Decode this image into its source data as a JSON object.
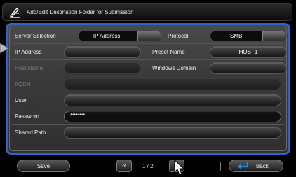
{
  "title": {
    "text": "Add/Edit Destination Folder for Submission",
    "icon": "folder-edit-icon"
  },
  "form": {
    "server_selection_label": "Server Selection",
    "server_selection_value": "IP Address",
    "protocol_label": "Protocol",
    "protocol_value": "SMB",
    "ip_address_label": "IP Address",
    "ip_address_value": "",
    "preset_name_label": "Preset Name",
    "preset_name_value": "HOST1",
    "host_name_label": "Host Name",
    "host_name_value": "",
    "windows_domain_label": "Windows Domain",
    "windows_domain_value": "",
    "fqdn_label": "FQDN",
    "fqdn_value": "",
    "user_label": "User",
    "user_value": "",
    "password_label": "Password",
    "password_value": "********",
    "shared_path_label": "Shared Path",
    "shared_path_value": ""
  },
  "footer": {
    "save_label": "Save",
    "prev_label": "«",
    "page_indicator": "1 / 2",
    "next_label": "»",
    "back_label": "Back"
  },
  "colors": {
    "accent_border": "#2f63c8",
    "back_arrow": "#1f8fe8"
  }
}
